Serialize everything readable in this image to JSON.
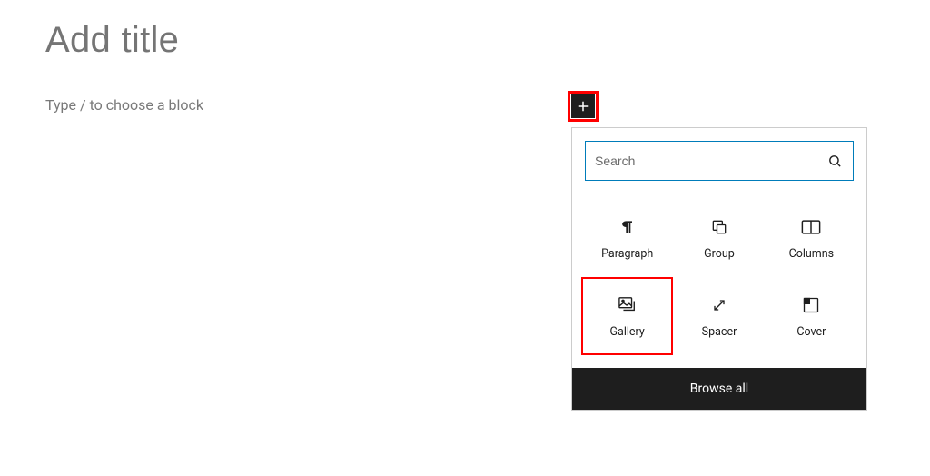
{
  "editor": {
    "title_placeholder": "Add title",
    "block_placeholder": "Type / to choose a block"
  },
  "inserter": {
    "search_placeholder": "Search",
    "blocks": [
      {
        "id": "paragraph",
        "label": "Paragraph",
        "icon": "paragraph-icon"
      },
      {
        "id": "group",
        "label": "Group",
        "icon": "group-icon"
      },
      {
        "id": "columns",
        "label": "Columns",
        "icon": "columns-icon"
      },
      {
        "id": "gallery",
        "label": "Gallery",
        "icon": "gallery-icon",
        "highlighted": true
      },
      {
        "id": "spacer",
        "label": "Spacer",
        "icon": "spacer-icon"
      },
      {
        "id": "cover",
        "label": "Cover",
        "icon": "cover-icon"
      }
    ],
    "browse_all_label": "Browse all"
  },
  "colors": {
    "highlight": "#ff0000",
    "focus": "#007cba",
    "dark": "#1e1e1e"
  }
}
